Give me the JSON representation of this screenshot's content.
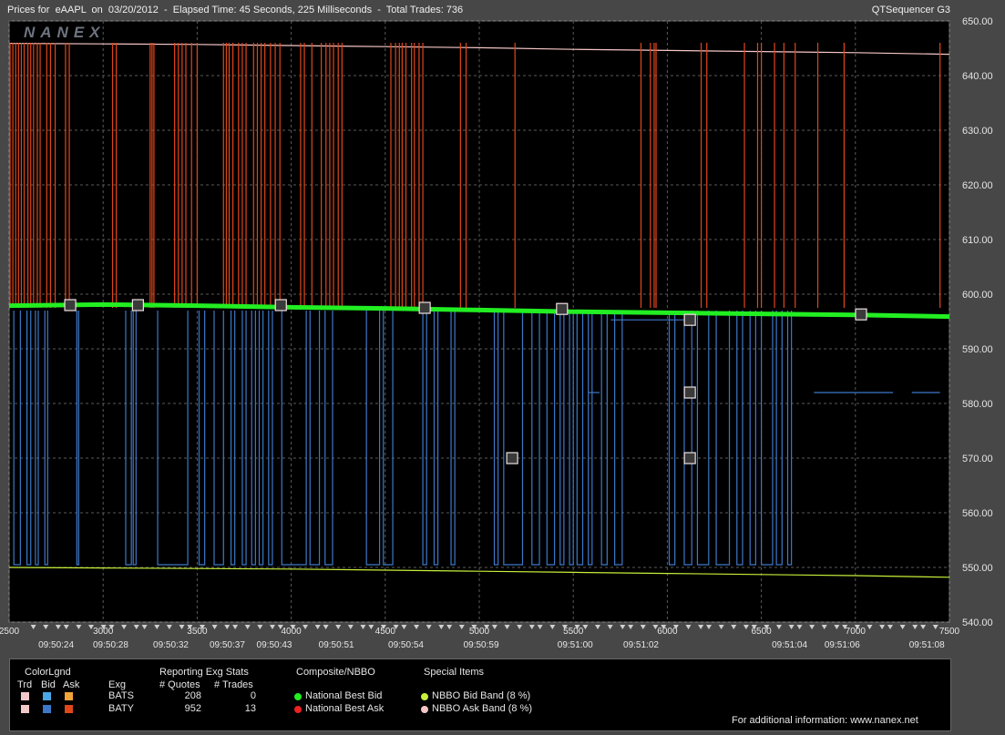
{
  "header": {
    "title_left": "Prices for  eAAPL  on  03/20/2012  -  Elapsed Time: 45 Seconds, 225 Milliseconds  -  Total Trades: 736",
    "title_right": "QTSequencer G3",
    "watermark": "NANEX"
  },
  "colors": {
    "bats_trade": "#f2c8c8",
    "bats_bid": "#4aa7e6",
    "bats_ask": "#f2a33a",
    "baty_trade": "#f2c8c8",
    "baty_bid": "#3d78c8",
    "baty_ask": "#e0471a",
    "nbbo_bid": "#22ee22",
    "nbbo_ask": "#ee2222",
    "bid_band": "#c6f03a",
    "ask_band": "#f7c6c6"
  },
  "chart_data": {
    "type": "line",
    "x_axis": {
      "range": [
        2500,
        7500
      ],
      "ticks": [
        2500,
        3000,
        3500,
        4000,
        4500,
        5000,
        5500,
        6000,
        6500,
        7000,
        7500
      ],
      "time_labels": [
        {
          "x": 2750,
          "t": "09:50:24"
        },
        {
          "x": 3040,
          "t": "09:50:28"
        },
        {
          "x": 3360,
          "t": "09:50:32"
        },
        {
          "x": 3660,
          "t": "09:50:37"
        },
        {
          "x": 3910,
          "t": "09:50:43"
        },
        {
          "x": 4240,
          "t": "09:50:51"
        },
        {
          "x": 4610,
          "t": "09:50:54"
        },
        {
          "x": 5010,
          "t": "09:50:59"
        },
        {
          "x": 5510,
          "t": "09:51:00"
        },
        {
          "x": 5860,
          "t": "09:51:02"
        },
        {
          "x": 6650,
          "t": "09:51:04"
        },
        {
          "x": 6930,
          "t": "09:51:06"
        },
        {
          "x": 7380,
          "t": "09:51:08"
        }
      ]
    },
    "y_axis": {
      "range": [
        540,
        650
      ],
      "ticks": [
        540,
        550,
        560,
        570,
        580,
        590,
        600,
        610,
        620,
        630,
        640,
        650
      ],
      "tick_labels": [
        "540.00",
        "550.00",
        "560.00",
        "570.00",
        "580.00",
        "590.00",
        "600.00",
        "610.00",
        "620.00",
        "630.00",
        "640.00",
        "650.00"
      ]
    },
    "grid": true,
    "series": [
      {
        "name": "National Best Bid",
        "points": [
          [
            2500,
            597.9
          ],
          [
            3000,
            598.1
          ],
          [
            3500,
            597.9
          ],
          [
            4000,
            597.6
          ],
          [
            4500,
            597.4
          ],
          [
            5000,
            597.1
          ],
          [
            5500,
            596.8
          ],
          [
            6000,
            596.6
          ],
          [
            6500,
            596.4
          ],
          [
            7000,
            596.2
          ],
          [
            7500,
            595.9
          ]
        ]
      },
      {
        "name": "NBBO Bid Band (8 %)",
        "points": [
          [
            2500,
            550.0
          ],
          [
            3000,
            549.9
          ],
          [
            3500,
            549.8
          ],
          [
            4000,
            549.7
          ],
          [
            4500,
            549.5
          ],
          [
            5000,
            549.3
          ],
          [
            5500,
            549.1
          ],
          [
            6000,
            548.9
          ],
          [
            6500,
            548.7
          ],
          [
            7000,
            548.5
          ],
          [
            7500,
            548.2
          ]
        ]
      },
      {
        "name": "NBBO Ask Band (8 %)",
        "points": [
          [
            2500,
            645.9
          ],
          [
            3000,
            645.8
          ],
          [
            3500,
            645.7
          ],
          [
            4000,
            645.5
          ],
          [
            4500,
            645.3
          ],
          [
            5000,
            645.1
          ],
          [
            5500,
            644.8
          ],
          [
            6000,
            644.6
          ],
          [
            6500,
            644.4
          ],
          [
            7000,
            644.2
          ],
          [
            7500,
            643.9
          ]
        ]
      }
    ],
    "baty_ask_spikes_x": [
      2505,
      2520,
      2535,
      2550,
      2565,
      2580,
      2600,
      2615,
      2630,
      2650,
      2665,
      2700,
      2720,
      2745,
      2800,
      2820,
      3050,
      3070,
      3250,
      3260,
      3270,
      3380,
      3400,
      3420,
      3440,
      3470,
      3500,
      3640,
      3655,
      3670,
      3690,
      3720,
      3740,
      3760,
      3800,
      3820,
      3840,
      3860,
      3890,
      3915,
      3940,
      4050,
      4070,
      4110,
      4160,
      4185,
      4205,
      4225,
      4250,
      4270,
      4530,
      4555,
      4575,
      4590,
      4610,
      4640,
      4655,
      4680,
      4700,
      4900,
      4930,
      5190,
      5860,
      5910,
      5930,
      5940,
      6180,
      6210,
      6410,
      6480,
      6500,
      6570,
      6620,
      6680,
      6800,
      6940,
      7450
    ],
    "baty_ask_top": 646,
    "baty_bid_dips": [
      [
        2525,
        2560
      ],
      [
        2595,
        2615
      ],
      [
        2640,
        2655
      ],
      [
        2690,
        2705
      ],
      [
        2860,
        2870
      ],
      [
        3120,
        3150
      ],
      [
        3160,
        3175
      ],
      [
        3290,
        3450
      ],
      [
        3510,
        3540
      ],
      [
        3590,
        3640
      ],
      [
        3680,
        3700
      ],
      [
        3740,
        3760
      ],
      [
        3790,
        3810
      ],
      [
        3830,
        3850
      ],
      [
        3880,
        3900
      ],
      [
        3950,
        4080
      ],
      [
        4100,
        4150
      ],
      [
        4180,
        4220
      ],
      [
        4400,
        4470
      ],
      [
        4490,
        4540
      ],
      [
        4700,
        4720
      ],
      [
        4760,
        4780
      ],
      [
        4850,
        4870
      ],
      [
        5080,
        5100
      ],
      [
        5130,
        5230
      ],
      [
        5280,
        5320
      ],
      [
        5360,
        5400
      ],
      [
        5430,
        5450
      ],
      [
        5480,
        5500
      ],
      [
        5520,
        5550
      ],
      [
        5580,
        5600
      ],
      [
        5650,
        5680
      ],
      [
        5720,
        5760
      ],
      [
        6010,
        6040
      ],
      [
        6090,
        6130
      ],
      [
        6160,
        6220
      ],
      [
        6260,
        6330
      ],
      [
        6370,
        6400
      ],
      [
        6440,
        6470
      ],
      [
        6500,
        6560
      ],
      [
        6580,
        6610
      ],
      [
        6640,
        6660
      ]
    ],
    "baty_bid_bottom": 550.5,
    "baty_bid_steps": [
      {
        "x": [
          5580,
          5640
        ],
        "y": 582
      },
      {
        "x": [
          5700,
          6100
        ],
        "y": 595.3
      },
      {
        "x": [
          6780,
          7000
        ],
        "y": 582
      },
      {
        "x": [
          7000,
          7200
        ],
        "y": 582
      },
      {
        "x": [
          7300,
          7450
        ],
        "y": 582
      }
    ],
    "trade_markers": [
      {
        "x": 2825,
        "y": 598.0
      },
      {
        "x": 3185,
        "y": 598.0
      },
      {
        "x": 3945,
        "y": 598.0
      },
      {
        "x": 4710,
        "y": 597.5
      },
      {
        "x": 5175,
        "y": 570.0
      },
      {
        "x": 5440,
        "y": 597.3
      },
      {
        "x": 6120,
        "y": 595.3
      },
      {
        "x": 6120,
        "y": 582.0
      },
      {
        "x": 6120,
        "y": 570.0
      },
      {
        "x": 7030,
        "y": 596.3
      }
    ]
  },
  "legend": {
    "color_legend_title": "ColorLgnd",
    "col_trd": "Trd",
    "col_bid": "Bid",
    "col_ask": "Ask",
    "col_exg": "Exg",
    "stats_title": "Reporting Exg Stats",
    "col_quotes": "# Quotes",
    "col_trades": "# Trades",
    "rows": [
      {
        "exg": "BATS",
        "quotes": "208",
        "trades": "0"
      },
      {
        "exg": "BATY",
        "quotes": "952",
        "trades": "13"
      }
    ],
    "composite_title": "Composite/NBBO",
    "nbb_label": "National Best Bid",
    "nbo_label": "National Best Ask",
    "special_title": "Special Items",
    "bid_band_label": "NBBO Bid Band (8 %)",
    "ask_band_label": "NBBO Ask Band (8 %)",
    "footer": "For additional information: www.nanex.net"
  }
}
